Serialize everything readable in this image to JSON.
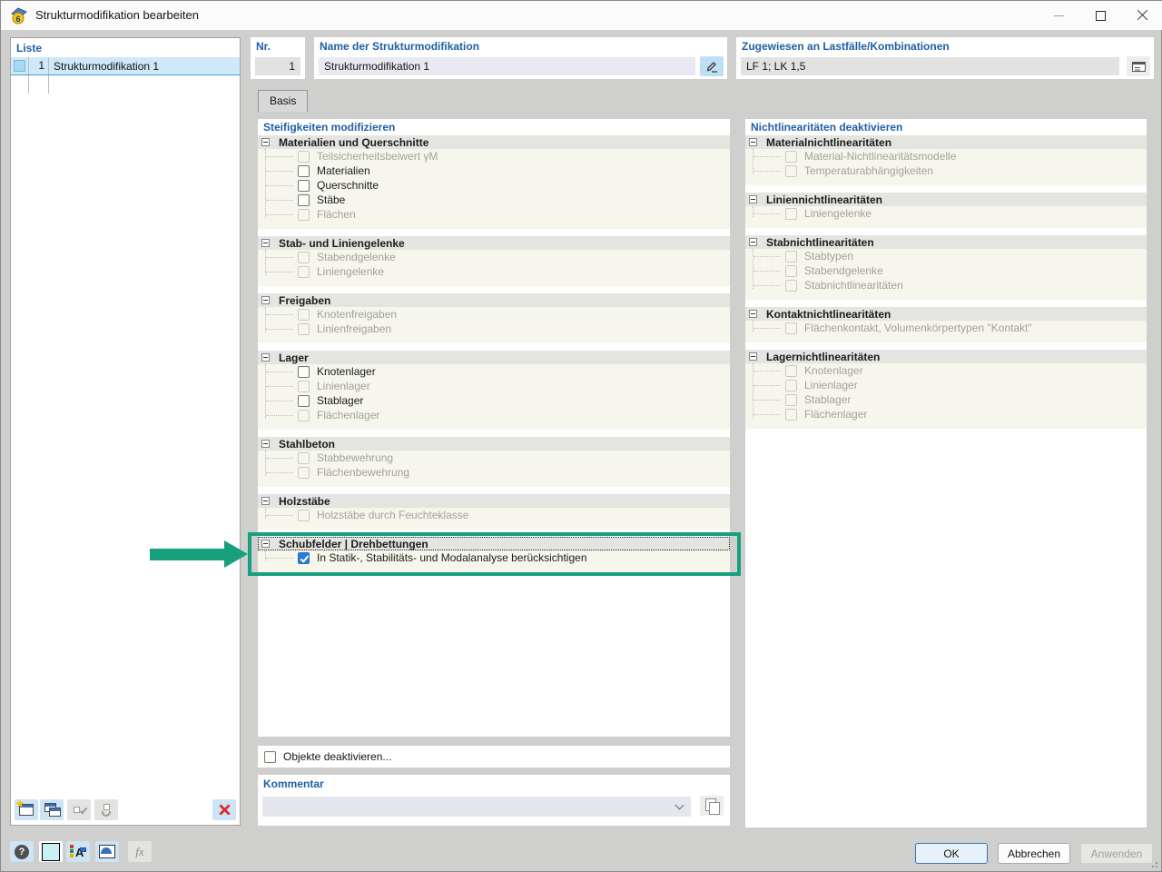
{
  "window": {
    "title": "Strukturmodifikation bearbeiten"
  },
  "icons": {
    "app_digit": "6",
    "help_glyph": "?",
    "fx_glyph": "fx",
    "display_letter": "A"
  },
  "list_panel": {
    "header": "Liste",
    "rows": [
      {
        "nr": "1",
        "name": "Strukturmodifikation 1",
        "selected": true
      }
    ]
  },
  "fields": {
    "nr": {
      "label": "Nr.",
      "value": "1"
    },
    "name": {
      "label": "Name der Strukturmodifikation",
      "value": "Strukturmodifikation 1"
    },
    "assigned": {
      "label": "Zugewiesen an Lastfälle/Kombinationen",
      "value": "LF 1; LK 1,5"
    }
  },
  "tabs": [
    {
      "label": "Basis",
      "active": true
    }
  ],
  "left_column": {
    "header": "Steifigkeiten modifizieren",
    "groups": [
      {
        "title": "Materialien und Querschnitte",
        "items": [
          {
            "label": "Teilsicherheitsbeiwert γM",
            "enabled": false,
            "checked": false
          },
          {
            "label": "Materialien",
            "enabled": true,
            "checked": false
          },
          {
            "label": "Querschnitte",
            "enabled": true,
            "checked": false
          },
          {
            "label": "Stäbe",
            "enabled": true,
            "checked": false
          },
          {
            "label": "Flächen",
            "enabled": false,
            "checked": false
          }
        ]
      },
      {
        "title": "Stab- und Liniengelenke",
        "items": [
          {
            "label": "Stabendgelenke",
            "enabled": false,
            "checked": false
          },
          {
            "label": "Liniengelenke",
            "enabled": false,
            "checked": false
          }
        ]
      },
      {
        "title": "Freigaben",
        "items": [
          {
            "label": "Knotenfreigaben",
            "enabled": false,
            "checked": false
          },
          {
            "label": "Linienfreigaben",
            "enabled": false,
            "checked": false
          }
        ]
      },
      {
        "title": "Lager",
        "items": [
          {
            "label": "Knotenlager",
            "enabled": true,
            "checked": false
          },
          {
            "label": "Linienlager",
            "enabled": false,
            "checked": false
          },
          {
            "label": "Stablager",
            "enabled": true,
            "checked": false
          },
          {
            "label": "Flächenlager",
            "enabled": false,
            "checked": false
          }
        ]
      },
      {
        "title": "Stahlbeton",
        "items": [
          {
            "label": "Stabbewehrung",
            "enabled": false,
            "checked": false
          },
          {
            "label": "Flächenbewehrung",
            "enabled": false,
            "checked": false
          }
        ]
      },
      {
        "title": "Holzstäbe",
        "items": [
          {
            "label": "Holzstäbe durch Feuchteklasse",
            "enabled": false,
            "checked": false
          }
        ]
      },
      {
        "title": "Schubfelder | Drehbettungen",
        "focused": true,
        "highlighted": true,
        "items": [
          {
            "label": "In Statik-, Stabilitäts- und Modalanalyse berücksichtigen",
            "enabled": true,
            "checked": true
          }
        ]
      }
    ]
  },
  "right_column": {
    "header": "Nichtlinearitäten deaktivieren",
    "groups": [
      {
        "title": "Materialnichtlinearitäten",
        "items": [
          {
            "label": "Material-Nichtlinearitätsmodelle",
            "enabled": false,
            "checked": false
          },
          {
            "label": "Temperaturabhängigkeiten",
            "enabled": false,
            "checked": false
          }
        ]
      },
      {
        "title": "Liniennichtlinearitäten",
        "items": [
          {
            "label": "Liniengelenke",
            "enabled": false,
            "checked": false
          }
        ]
      },
      {
        "title": "Stabnichtlinearitäten",
        "items": [
          {
            "label": "Stabtypen",
            "enabled": false,
            "checked": false
          },
          {
            "label": "Stabendgelenke",
            "enabled": false,
            "checked": false
          },
          {
            "label": "Stabnichtlinearitäten",
            "enabled": false,
            "checked": false
          }
        ]
      },
      {
        "title": "Kontaktnichtlinearitäten",
        "items": [
          {
            "label": "Flächenkontakt, Volumenkörpertypen \"Kontakt\"",
            "enabled": false,
            "checked": false
          }
        ]
      },
      {
        "title": "Lagernichtlinearitäten",
        "items": [
          {
            "label": "Knotenlager",
            "enabled": false,
            "checked": false
          },
          {
            "label": "Linienlager",
            "enabled": false,
            "checked": false
          },
          {
            "label": "Stablager",
            "enabled": false,
            "checked": false
          },
          {
            "label": "Flächenlager",
            "enabled": false,
            "checked": false
          }
        ]
      }
    ]
  },
  "bottom": {
    "deactivate_objects": {
      "label": "Objekte deaktivieren...",
      "checked": false
    },
    "comment": {
      "label": "Kommentar",
      "value": ""
    }
  },
  "footer_buttons": {
    "ok": "OK",
    "cancel": "Abbrechen",
    "apply": "Anwenden"
  },
  "colors": {
    "highlight_green": "#17a07e",
    "selection_blue": "#cfe9f8",
    "checkbox_blue": "#2b7cd6",
    "label_blue": "#1f5fa2"
  }
}
